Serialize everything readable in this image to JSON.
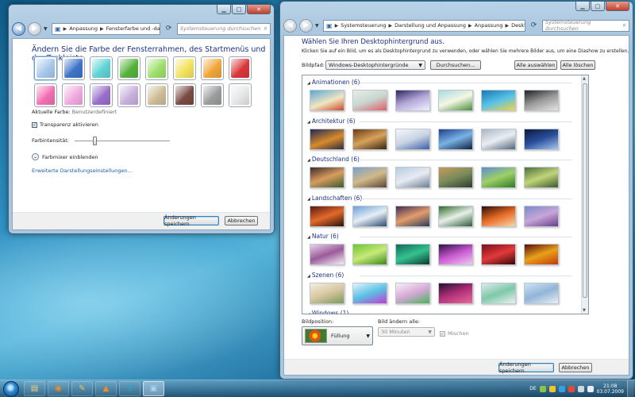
{
  "colors": {
    "link": "#1f5aa8",
    "heading": "#1e3287"
  },
  "left_window": {
    "breadcrumb": [
      "Anpassung",
      "Fensterfarbe und -darstellung"
    ],
    "search_placeholder": "Systemsteuerung durchsuchen",
    "heading": "Ändern Sie die Farbe der Fensterrahmen, des Startmenüs und der Taskleiste.",
    "swatches": [
      {
        "color": "#a6c8ec",
        "selected": true
      },
      {
        "color": "#3f74c9"
      },
      {
        "color": "#5fd3d6"
      },
      {
        "color": "#55b33d"
      },
      {
        "color": "#9ee06a"
      },
      {
        "color": "#f2e35c"
      },
      {
        "color": "#f0a63a"
      },
      {
        "color": "#d9383a"
      },
      {
        "color": "#f26fb3"
      },
      {
        "color": "#f2a9df"
      },
      {
        "color": "#9a6fcb"
      },
      {
        "color": "#c8b0dd"
      },
      {
        "color": "#cdbc95"
      },
      {
        "color": "#7a4b45"
      },
      {
        "color": "#9c9c9c"
      },
      {
        "color": "#e6e6e6"
      }
    ],
    "current_color_label": "Aktuelle Farbe:",
    "current_color_value": "Benutzerdefiniert",
    "transparency_label": "Transparenz aktivieren",
    "transparency_checked": true,
    "intensity_label": "Farbintensität:",
    "intensity_value": 0.2,
    "mixer_label": "Farbmixer einblenden",
    "advanced_link": "Erweiterte Darstellungseinstellungen...",
    "save_button": "Änderungen speichern",
    "cancel_button": "Abbrechen"
  },
  "right_window": {
    "breadcrumb": [
      "Systemsteuerung",
      "Darstellung und Anpassung",
      "Anpassung",
      "Desktophintergrund"
    ],
    "search_placeholder": "Systemsteuerung durchsuchen",
    "heading": "Wählen Sie Ihren Desktophintergrund aus.",
    "subtext": "Klicken Sie auf ein Bild, um es als Desktophintergrund zu verwenden, oder wählen Sie mehrere Bilder aus, um eine Diashow zu erstellen.",
    "path_label": "Bildpfad:",
    "path_value": "Windows-Desktophintergründe",
    "browse_button": "Durchsuchen...",
    "select_all_button": "Alle auswählen",
    "clear_all_button": "Alle löschen",
    "groups": [
      {
        "title": "Animationen (6)",
        "thumbs": [
          "linear-gradient(160deg,#5aa7d8,#f2e6c0 55%,#c84a2a)",
          "linear-gradient(160deg,#e8ece6,#c7d7cf 50%,#e45b68)",
          "linear-gradient(160deg,#2f2560,#b3a9d9 50%,#f3f0ff)",
          "linear-gradient(160deg,#a8d9e6,#f4f7e2 50%,#4a8a3b)",
          "linear-gradient(160deg,#1a78b6,#56c2e6 50%,#f2d34a)",
          "linear-gradient(160deg,#222,#9a9a9a 50%,#e5e5e5)"
        ]
      },
      {
        "title": "Architektur (6)",
        "thumbs": [
          "linear-gradient(160deg,#1e2a55,#d98a2b 55%,#2c2c3c)",
          "linear-gradient(160deg,#6a3b12,#d7a25b 50%,#3a2410)",
          "linear-gradient(160deg,#f5f7fb,#c8d3e3 50%,#3d5fa8)",
          "linear-gradient(160deg,#1d3f8c,#7ab3e5 50%,#0f1f40)",
          "linear-gradient(160deg,#a9b6c4,#e9eef3 50%,#52657a)",
          "linear-gradient(160deg,#0b1a3a,#2b4f9c 50%,#a6c7f0)"
        ]
      },
      {
        "title": "Deutschland (6)",
        "thumbs": [
          "linear-gradient(160deg,#3e2a2a,#d89c5e 50%,#3a5b2c)",
          "linear-gradient(160deg,#7aa0c9,#d1b98a 50%,#5c4632)",
          "linear-gradient(160deg,#b7cbe2,#e8ebf1 50%,#6c7c96)",
          "linear-gradient(160deg,#c79a5b,#7a8b5c 50%,#2e3c2a)",
          "linear-gradient(160deg,#5b8fd1,#9ed067 50%,#2f7a24)",
          "linear-gradient(160deg,#4c6f3c,#c2d47a 50%,#3b5a2a)"
        ]
      },
      {
        "title": "Landschaften (6)",
        "thumbs": [
          "linear-gradient(160deg,#5a1a10,#e26a2a 50%,#2a0f0a)",
          "linear-gradient(160deg,#6aa0d6,#e6eef5 50%,#2d4c72)",
          "linear-gradient(160deg,#3c2f55,#e59c6b 50%,#2c3c5e)",
          "linear-gradient(160deg,#2f6a2c,#e7f0e8 50%,#2e5a37)",
          "linear-gradient(160deg,#2a0f08,#e76a24 50%,#f7d8a8)",
          "linear-gradient(160deg,#7b89c7,#c7a6d9 50%,#6a3e8a)"
        ]
      },
      {
        "title": "Natur (6)",
        "thumbs": [
          "linear-gradient(160deg,#e6d3e9,#9b5a9a 50%,#f5f0f5)",
          "linear-gradient(160deg,#6cc62c,#c7e97a 50%,#3b8a1a)",
          "linear-gradient(160deg,#0f6a5a,#35c28f 50%,#083a30)",
          "linear-gradient(160deg,#2d1244,#c95ad1 50%,#efc9f0)",
          "linear-gradient(160deg,#7a0f1a,#e23a3a 50%,#3a0609)",
          "linear-gradient(160deg,#5a0d0d,#e9a01a 50%,#c23a0a)"
        ]
      },
      {
        "title": "Szenen (6)",
        "thumbs": [
          "linear-gradient(160deg,#f3efe0,#d8c6a0 50%,#7a9a5a)",
          "linear-gradient(160deg,#e2f3fb,#5ac1e6 50%,#c43ad0)",
          "linear-gradient(160deg,#f6f1f5,#d6a8d8 50%,#4ab35a)",
          "linear-gradient(160deg,#24102e,#b2307a 50%,#e96a9a)",
          "linear-gradient(160deg,#d9ecef,#7ec8a8 50%,#e9f1f3)",
          "linear-gradient(160deg,#cfe3f6,#92b4d8 50%,#e8f0f7)"
        ]
      },
      {
        "title": "Windows (1)",
        "thumbs": []
      }
    ],
    "position_label": "Bildposition:",
    "position_value": "Füllung",
    "change_label": "Bild ändern alle:",
    "change_value": "30 Minuten",
    "shuffle_label": "Mischen",
    "save_button": "Änderungen speichern",
    "cancel_button": "Abbrechen"
  },
  "taskbar": {
    "apps": [
      "folder-icon",
      "firefox-icon",
      "notepad-icon",
      "vlc-icon",
      "skype-icon",
      "control-panel-icon"
    ],
    "language": "DE",
    "time": "21:08",
    "date": "03.07.2009"
  }
}
